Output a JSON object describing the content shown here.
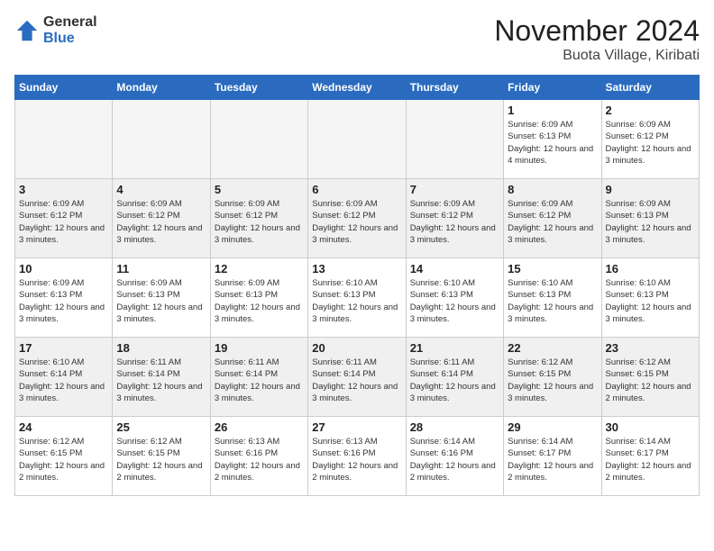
{
  "logo": {
    "general": "General",
    "blue": "Blue"
  },
  "header": {
    "month": "November 2024",
    "location": "Buota Village, Kiribati"
  },
  "weekdays": [
    "Sunday",
    "Monday",
    "Tuesday",
    "Wednesday",
    "Thursday",
    "Friday",
    "Saturday"
  ],
  "weeks": [
    [
      {
        "day": "",
        "empty": true
      },
      {
        "day": "",
        "empty": true
      },
      {
        "day": "",
        "empty": true
      },
      {
        "day": "",
        "empty": true
      },
      {
        "day": "",
        "empty": true
      },
      {
        "day": "1",
        "sunrise": "6:09 AM",
        "sunset": "6:13 PM",
        "daylight": "12 hours and 4 minutes."
      },
      {
        "day": "2",
        "sunrise": "6:09 AM",
        "sunset": "6:12 PM",
        "daylight": "12 hours and 3 minutes."
      }
    ],
    [
      {
        "day": "3",
        "sunrise": "6:09 AM",
        "sunset": "6:12 PM",
        "daylight": "12 hours and 3 minutes."
      },
      {
        "day": "4",
        "sunrise": "6:09 AM",
        "sunset": "6:12 PM",
        "daylight": "12 hours and 3 minutes."
      },
      {
        "day": "5",
        "sunrise": "6:09 AM",
        "sunset": "6:12 PM",
        "daylight": "12 hours and 3 minutes."
      },
      {
        "day": "6",
        "sunrise": "6:09 AM",
        "sunset": "6:12 PM",
        "daylight": "12 hours and 3 minutes."
      },
      {
        "day": "7",
        "sunrise": "6:09 AM",
        "sunset": "6:12 PM",
        "daylight": "12 hours and 3 minutes."
      },
      {
        "day": "8",
        "sunrise": "6:09 AM",
        "sunset": "6:12 PM",
        "daylight": "12 hours and 3 minutes."
      },
      {
        "day": "9",
        "sunrise": "6:09 AM",
        "sunset": "6:13 PM",
        "daylight": "12 hours and 3 minutes."
      }
    ],
    [
      {
        "day": "10",
        "sunrise": "6:09 AM",
        "sunset": "6:13 PM",
        "daylight": "12 hours and 3 minutes."
      },
      {
        "day": "11",
        "sunrise": "6:09 AM",
        "sunset": "6:13 PM",
        "daylight": "12 hours and 3 minutes."
      },
      {
        "day": "12",
        "sunrise": "6:09 AM",
        "sunset": "6:13 PM",
        "daylight": "12 hours and 3 minutes."
      },
      {
        "day": "13",
        "sunrise": "6:10 AM",
        "sunset": "6:13 PM",
        "daylight": "12 hours and 3 minutes."
      },
      {
        "day": "14",
        "sunrise": "6:10 AM",
        "sunset": "6:13 PM",
        "daylight": "12 hours and 3 minutes."
      },
      {
        "day": "15",
        "sunrise": "6:10 AM",
        "sunset": "6:13 PM",
        "daylight": "12 hours and 3 minutes."
      },
      {
        "day": "16",
        "sunrise": "6:10 AM",
        "sunset": "6:13 PM",
        "daylight": "12 hours and 3 minutes."
      }
    ],
    [
      {
        "day": "17",
        "sunrise": "6:10 AM",
        "sunset": "6:14 PM",
        "daylight": "12 hours and 3 minutes."
      },
      {
        "day": "18",
        "sunrise": "6:11 AM",
        "sunset": "6:14 PM",
        "daylight": "12 hours and 3 minutes."
      },
      {
        "day": "19",
        "sunrise": "6:11 AM",
        "sunset": "6:14 PM",
        "daylight": "12 hours and 3 minutes."
      },
      {
        "day": "20",
        "sunrise": "6:11 AM",
        "sunset": "6:14 PM",
        "daylight": "12 hours and 3 minutes."
      },
      {
        "day": "21",
        "sunrise": "6:11 AM",
        "sunset": "6:14 PM",
        "daylight": "12 hours and 3 minutes."
      },
      {
        "day": "22",
        "sunrise": "6:12 AM",
        "sunset": "6:15 PM",
        "daylight": "12 hours and 3 minutes."
      },
      {
        "day": "23",
        "sunrise": "6:12 AM",
        "sunset": "6:15 PM",
        "daylight": "12 hours and 2 minutes."
      }
    ],
    [
      {
        "day": "24",
        "sunrise": "6:12 AM",
        "sunset": "6:15 PM",
        "daylight": "12 hours and 2 minutes."
      },
      {
        "day": "25",
        "sunrise": "6:12 AM",
        "sunset": "6:15 PM",
        "daylight": "12 hours and 2 minutes."
      },
      {
        "day": "26",
        "sunrise": "6:13 AM",
        "sunset": "6:16 PM",
        "daylight": "12 hours and 2 minutes."
      },
      {
        "day": "27",
        "sunrise": "6:13 AM",
        "sunset": "6:16 PM",
        "daylight": "12 hours and 2 minutes."
      },
      {
        "day": "28",
        "sunrise": "6:14 AM",
        "sunset": "6:16 PM",
        "daylight": "12 hours and 2 minutes."
      },
      {
        "day": "29",
        "sunrise": "6:14 AM",
        "sunset": "6:17 PM",
        "daylight": "12 hours and 2 minutes."
      },
      {
        "day": "30",
        "sunrise": "6:14 AM",
        "sunset": "6:17 PM",
        "daylight": "12 hours and 2 minutes."
      }
    ]
  ],
  "labels": {
    "sunrise": "Sunrise:",
    "sunset": "Sunset:",
    "daylight": "Daylight:"
  }
}
